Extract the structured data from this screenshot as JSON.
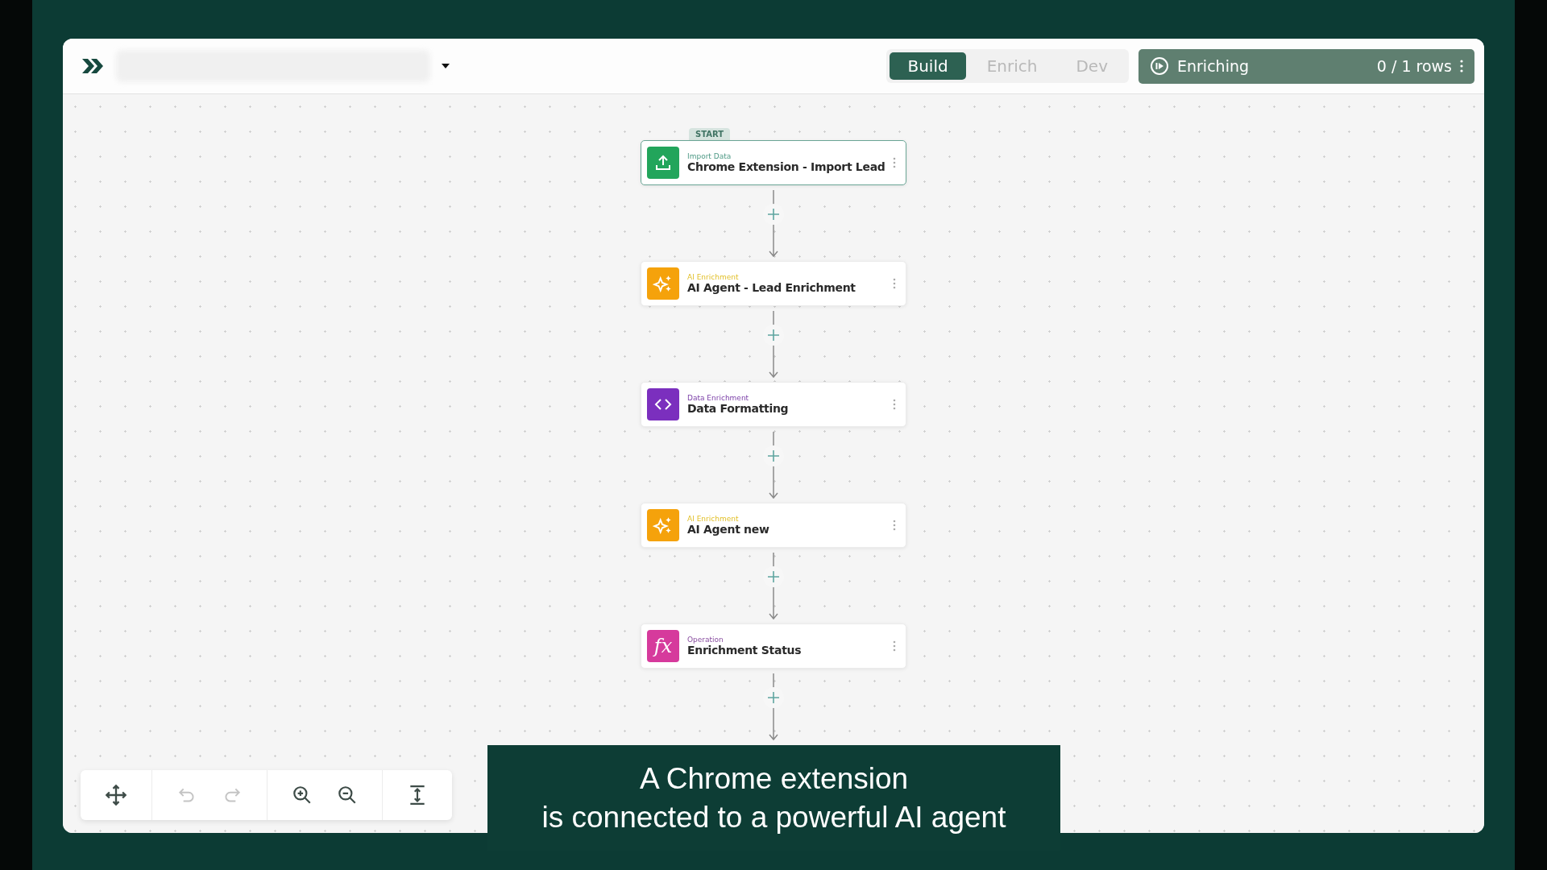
{
  "header": {
    "tabs": [
      {
        "label": "Build",
        "selected": true
      },
      {
        "label": "Enrich",
        "selected": false
      },
      {
        "label": "Dev",
        "selected": false
      }
    ],
    "status": {
      "label": "Enriching",
      "count": "0 / 1 rows"
    }
  },
  "flow": {
    "start_label": "START",
    "nodes": [
      {
        "kind": "import",
        "category": "Import Data",
        "title": "Chrome Extension - Import Lead",
        "selected": true
      },
      {
        "kind": "ai",
        "category": "AI Enrichment",
        "title": "AI Agent - Lead Enrichment",
        "selected": false
      },
      {
        "kind": "data",
        "category": "Data Enrichment",
        "title": "Data Formatting",
        "selected": false
      },
      {
        "kind": "ai",
        "category": "AI Enrichment",
        "title": "AI Agent new",
        "selected": false
      },
      {
        "kind": "operation",
        "category": "Operation",
        "title": "Enrichment Status",
        "selected": false,
        "icon_glyph": "fx"
      }
    ]
  },
  "toolbar": {
    "groups": [
      [
        {
          "kind": "pan",
          "disabled": false
        }
      ],
      [
        {
          "kind": "undo",
          "disabled": true
        },
        {
          "kind": "redo",
          "disabled": true
        }
      ],
      [
        {
          "kind": "zoom-in",
          "disabled": false
        },
        {
          "kind": "zoom-out",
          "disabled": false
        }
      ],
      [
        {
          "kind": "fit",
          "disabled": false
        }
      ]
    ]
  },
  "caption": {
    "lines": [
      "A Chrome extension",
      "is connected to a powerful AI agent"
    ]
  }
}
